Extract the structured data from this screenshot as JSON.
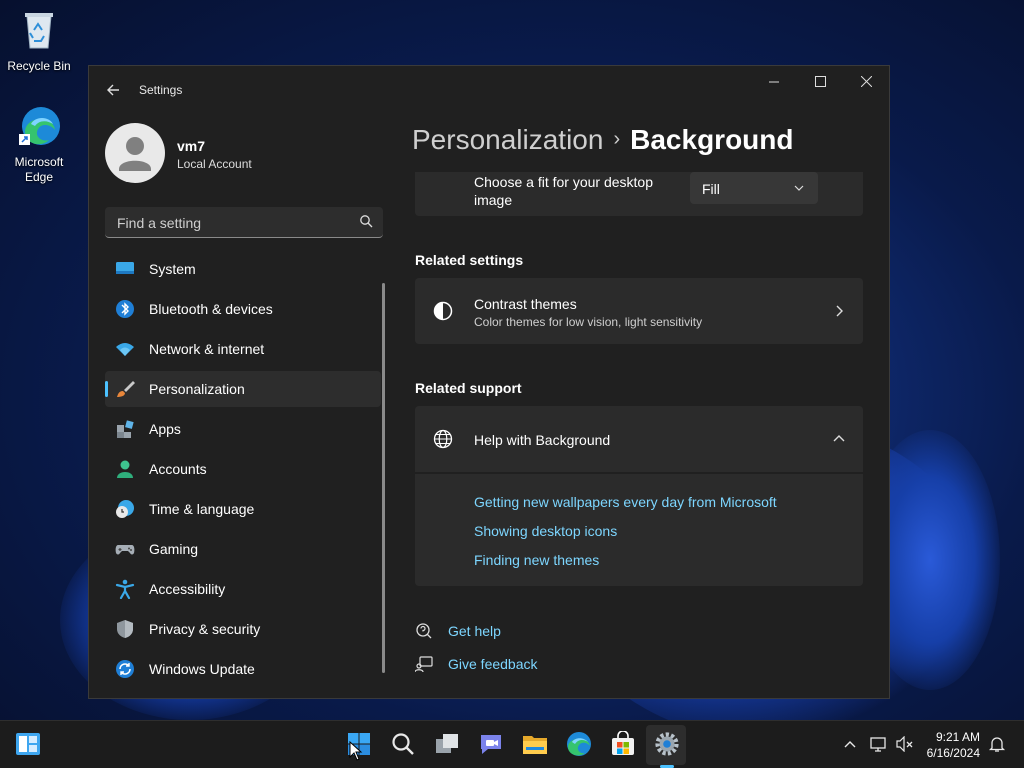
{
  "desktop": {
    "icons": [
      {
        "label": "Recycle Bin",
        "icon": "recycle-bin-icon"
      },
      {
        "label": "Microsoft Edge",
        "icon": "edge-icon"
      }
    ]
  },
  "window": {
    "title": "Settings",
    "controls": [
      "minimize",
      "maximize",
      "close"
    ]
  },
  "profile": {
    "name": "vm7",
    "account_type": "Local Account"
  },
  "search": {
    "placeholder": "Find a setting",
    "value": ""
  },
  "sidebar": {
    "items": [
      {
        "label": "System",
        "icon": "system-icon",
        "active": false
      },
      {
        "label": "Bluetooth & devices",
        "icon": "bluetooth-icon",
        "active": false
      },
      {
        "label": "Network & internet",
        "icon": "wifi-icon",
        "active": false
      },
      {
        "label": "Personalization",
        "icon": "paintbrush-icon",
        "active": true
      },
      {
        "label": "Apps",
        "icon": "apps-icon",
        "active": false
      },
      {
        "label": "Accounts",
        "icon": "person-icon",
        "active": false
      },
      {
        "label": "Time & language",
        "icon": "clock-globe-icon",
        "active": false
      },
      {
        "label": "Gaming",
        "icon": "gamepad-icon",
        "active": false
      },
      {
        "label": "Accessibility",
        "icon": "accessibility-icon",
        "active": false
      },
      {
        "label": "Privacy & security",
        "icon": "shield-icon",
        "active": false
      },
      {
        "label": "Windows Update",
        "icon": "windows-update-icon",
        "active": false
      }
    ]
  },
  "main": {
    "breadcrumb": {
      "parent": "Personalization",
      "separator": "›",
      "current": "Background"
    },
    "fit_setting": {
      "label_line1": "Choose a fit for your desktop",
      "label_line2": "image",
      "value": "Fill"
    },
    "related_settings": {
      "heading": "Related settings",
      "items": [
        {
          "title": "Contrast themes",
          "subtitle": "Color themes for low vision, light sensitivity"
        }
      ]
    },
    "related_support": {
      "heading": "Related support",
      "help_title": "Help with Background",
      "expanded": true,
      "links": [
        "Getting new wallpapers every day from Microsoft",
        "Showing desktop icons",
        "Finding new themes"
      ]
    },
    "footer_links": {
      "help": "Get help",
      "feedback": "Give feedback"
    }
  },
  "taskbar": {
    "apps": [
      "widgets-icon",
      "start-icon",
      "search-icon",
      "task-view-icon",
      "teams-chat-icon",
      "file-explorer-icon",
      "edge-icon",
      "store-icon",
      "settings-icon"
    ],
    "active_app": "settings-icon",
    "time": "9:21 AM",
    "date": "6/16/2024"
  },
  "colors": {
    "accent": "#4cc2ff",
    "link": "#7dd6ff",
    "window_bg": "#202020",
    "card_bg": "#2b2b2b"
  }
}
